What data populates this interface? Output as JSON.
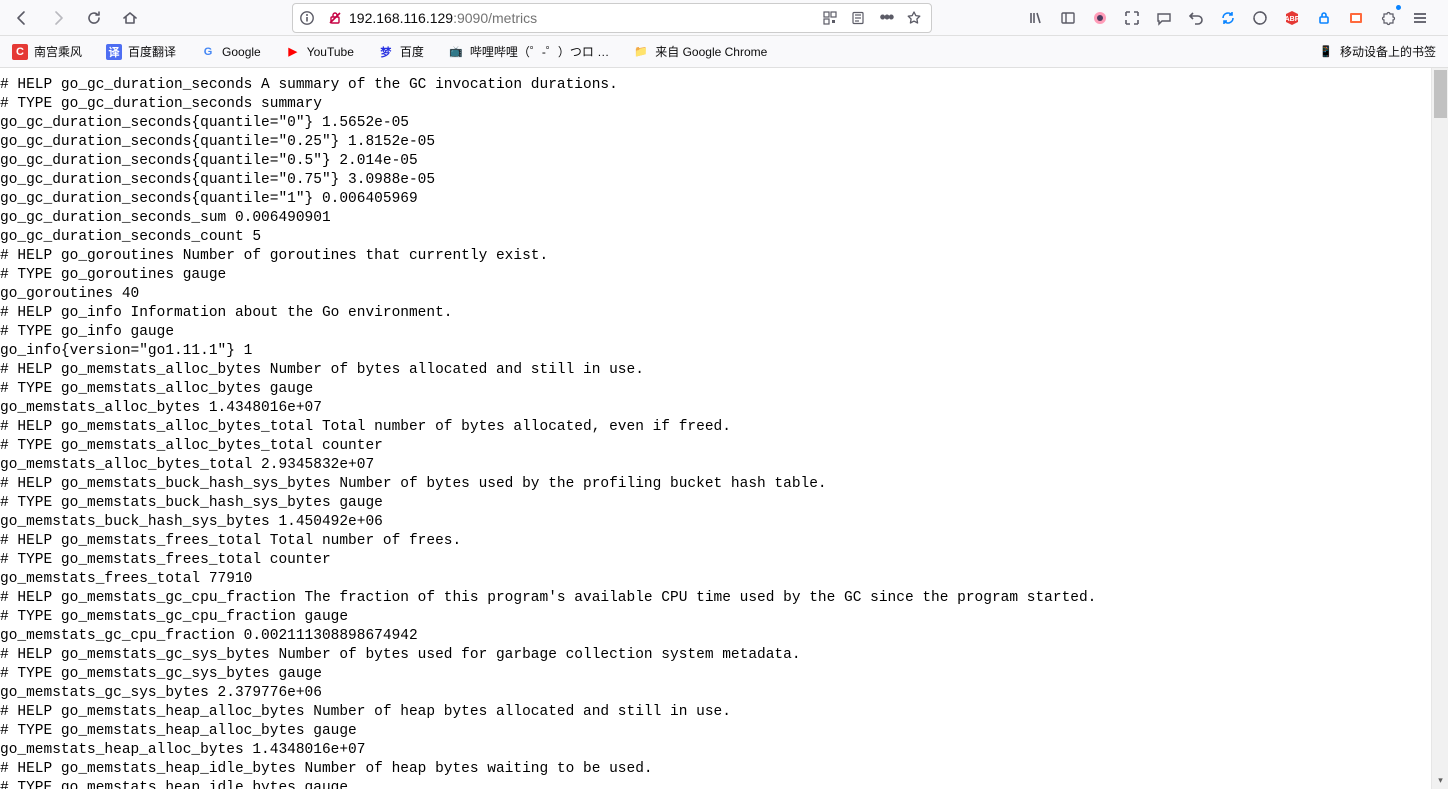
{
  "url": {
    "host": "192.168.116.129",
    "port": ":9090",
    "path": "/metrics"
  },
  "bookmarks": [
    {
      "label": "南宫乘风",
      "icon_bg": "#e53935",
      "icon_fg": "#fff",
      "icon_text": "C"
    },
    {
      "label": "百度翻译",
      "icon_bg": "#4e6ef2",
      "icon_fg": "#fff",
      "icon_text": "译"
    },
    {
      "label": "Google",
      "icon_bg": "transparent",
      "icon_fg": "#4285f4",
      "icon_text": "G"
    },
    {
      "label": "YouTube",
      "icon_bg": "transparent",
      "icon_fg": "#ff0000",
      "icon_text": "▶"
    },
    {
      "label": "百度",
      "icon_bg": "transparent",
      "icon_fg": "#2932e1",
      "icon_text": "梦"
    },
    {
      "label": "哔哩哔哩（゜-゜）つロ …",
      "icon_bg": "transparent",
      "icon_fg": "#00a1d6",
      "icon_text": "📺"
    },
    {
      "label": "来自 Google Chrome",
      "icon_bg": "transparent",
      "icon_fg": "#5b5b66",
      "icon_text": "📁"
    }
  ],
  "mobile_bookmark": "移动设备上的书签",
  "metrics_lines": [
    "# HELP go_gc_duration_seconds A summary of the GC invocation durations.",
    "# TYPE go_gc_duration_seconds summary",
    "go_gc_duration_seconds{quantile=\"0\"} 1.5652e-05",
    "go_gc_duration_seconds{quantile=\"0.25\"} 1.8152e-05",
    "go_gc_duration_seconds{quantile=\"0.5\"} 2.014e-05",
    "go_gc_duration_seconds{quantile=\"0.75\"} 3.0988e-05",
    "go_gc_duration_seconds{quantile=\"1\"} 0.006405969",
    "go_gc_duration_seconds_sum 0.006490901",
    "go_gc_duration_seconds_count 5",
    "# HELP go_goroutines Number of goroutines that currently exist.",
    "# TYPE go_goroutines gauge",
    "go_goroutines 40",
    "# HELP go_info Information about the Go environment.",
    "# TYPE go_info gauge",
    "go_info{version=\"go1.11.1\"} 1",
    "# HELP go_memstats_alloc_bytes Number of bytes allocated and still in use.",
    "# TYPE go_memstats_alloc_bytes gauge",
    "go_memstats_alloc_bytes 1.4348016e+07",
    "# HELP go_memstats_alloc_bytes_total Total number of bytes allocated, even if freed.",
    "# TYPE go_memstats_alloc_bytes_total counter",
    "go_memstats_alloc_bytes_total 2.9345832e+07",
    "# HELP go_memstats_buck_hash_sys_bytes Number of bytes used by the profiling bucket hash table.",
    "# TYPE go_memstats_buck_hash_sys_bytes gauge",
    "go_memstats_buck_hash_sys_bytes 1.450492e+06",
    "# HELP go_memstats_frees_total Total number of frees.",
    "# TYPE go_memstats_frees_total counter",
    "go_memstats_frees_total 77910",
    "# HELP go_memstats_gc_cpu_fraction The fraction of this program's available CPU time used by the GC since the program started.",
    "# TYPE go_memstats_gc_cpu_fraction gauge",
    "go_memstats_gc_cpu_fraction 0.002111308898674942",
    "# HELP go_memstats_gc_sys_bytes Number of bytes used for garbage collection system metadata.",
    "# TYPE go_memstats_gc_sys_bytes gauge",
    "go_memstats_gc_sys_bytes 2.379776e+06",
    "# HELP go_memstats_heap_alloc_bytes Number of heap bytes allocated and still in use.",
    "# TYPE go_memstats_heap_alloc_bytes gauge",
    "go_memstats_heap_alloc_bytes 1.4348016e+07",
    "# HELP go_memstats_heap_idle_bytes Number of heap bytes waiting to be used.",
    "# TYPE go_memstats_heap_idle_bytes gauge"
  ]
}
